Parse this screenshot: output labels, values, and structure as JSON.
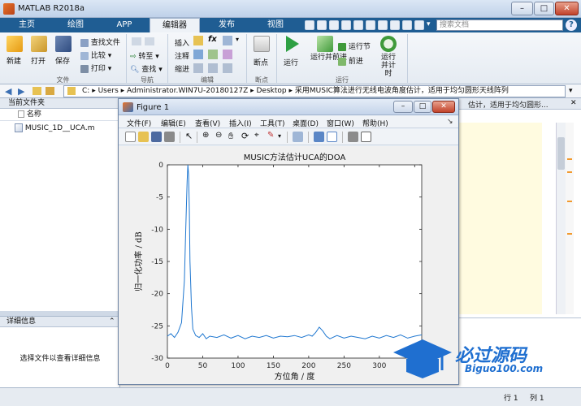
{
  "app": {
    "title": "MATLAB R2018a"
  },
  "window_buttons": {
    "minimize": "–",
    "maximize": "□",
    "close": "✕"
  },
  "tabs": [
    {
      "label": "主页"
    },
    {
      "label": "绘图"
    },
    {
      "label": "APP"
    },
    {
      "label": "编辑器",
      "active": true
    },
    {
      "label": "发布"
    },
    {
      "label": "视图"
    }
  ],
  "search": {
    "placeholder": "搜索文档"
  },
  "ribbon": {
    "file_group": {
      "caption": "文件",
      "new": "新建",
      "open": "打开",
      "save": "保存",
      "find_files": "查找文件",
      "compare": "比较",
      "print": "打印"
    },
    "nav_group": {
      "caption": "导航",
      "goto": "转至",
      "find": "查找"
    },
    "edit_group": {
      "caption": "编辑",
      "insert": "插入",
      "comment": "注释",
      "indent": "缩进",
      "fx": "fx"
    },
    "breakpoint_group": {
      "caption": "断点",
      "breakpoints": "断点"
    },
    "run_group": {
      "caption": "运行",
      "run": "运行",
      "run_advance": "运行并前进",
      "run_section": "运行节",
      "advance": "前进",
      "run_time": "运行并计时"
    }
  },
  "address": {
    "segments": [
      "C:",
      "Users",
      "Administrator.WIN7U-20180127Z",
      "Desktop",
      "采用MUSIC算法进行无线电波角度估计，适用于均匀圆形天线阵列"
    ]
  },
  "left_panel": {
    "title": "当前文件夹",
    "column_name": "名称",
    "files": [
      "MUSIC_1D__UCA.m"
    ]
  },
  "details": {
    "title": "详细信息",
    "placeholder": "选择文件以查看详细信息"
  },
  "editor": {
    "tab_text": "估计，适用于均匀圆形..."
  },
  "statusbar": {
    "row_label": "行",
    "row_value": "1",
    "col_label": "列",
    "col_value": "1"
  },
  "figure": {
    "title": "Figure 1",
    "menus": [
      "文件(F)",
      "编辑(E)",
      "查看(V)",
      "插入(I)",
      "工具(T)",
      "桌面(D)",
      "窗口(W)",
      "帮助(H)"
    ]
  },
  "watermark": {
    "title": "必过源码",
    "subtitle": "Biguo100.com"
  },
  "chart_data": {
    "type": "line",
    "title": "MUSIC方法估计UCA的DOA",
    "xlabel": "方位角 / 度",
    "ylabel": "归一化功率 / dB",
    "xlim": [
      0,
      360
    ],
    "ylim": [
      -30,
      0
    ],
    "xticks": [
      0,
      50,
      100,
      150,
      200,
      250,
      300,
      350
    ],
    "yticks": [
      0,
      -5,
      -10,
      -15,
      -20,
      -25,
      -30
    ],
    "grid": false,
    "series": [
      {
        "color": "#1f77d0",
        "x": [
          0,
          5,
          10,
          15,
          20,
          24,
          26,
          28,
          29,
          30,
          31,
          32,
          34,
          36,
          40,
          45,
          50,
          55,
          60,
          70,
          80,
          90,
          100,
          110,
          120,
          130,
          140,
          150,
          160,
          170,
          180,
          190,
          200,
          205,
          210,
          215,
          220,
          225,
          230,
          240,
          250,
          260,
          270,
          280,
          290,
          300,
          310,
          320,
          330,
          340,
          350,
          360
        ],
        "y": [
          -26.6,
          -26.2,
          -26.8,
          -26.0,
          -24.5,
          -18.0,
          -10.0,
          -2.5,
          0,
          -1.5,
          -7.0,
          -15.0,
          -22.0,
          -25.5,
          -26.5,
          -26.8,
          -26.2,
          -27.0,
          -26.6,
          -26.8,
          -26.4,
          -26.9,
          -26.5,
          -27.0,
          -26.6,
          -26.8,
          -26.5,
          -26.9,
          -26.6,
          -26.7,
          -26.5,
          -26.8,
          -26.4,
          -26.6,
          -26.0,
          -25.2,
          -25.8,
          -26.6,
          -27.0,
          -26.5,
          -26.9,
          -26.6,
          -26.8,
          -27.0,
          -26.6,
          -26.9,
          -26.5,
          -26.8,
          -26.4,
          -26.9,
          -26.6,
          -26.4
        ]
      }
    ]
  }
}
